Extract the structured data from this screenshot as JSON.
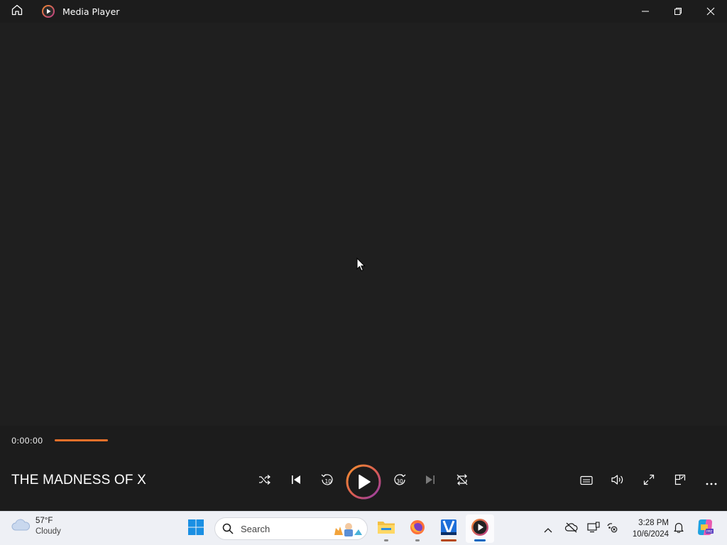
{
  "window": {
    "title": "Media Player"
  },
  "player": {
    "current_time": "0:00:00",
    "progress_fraction": 0.0,
    "track_title": "THE MADNESS OF X",
    "accent_color": "#e8702a"
  },
  "controls": {
    "left": [
      "shuffle-icon",
      "previous-icon",
      "rewind-10-icon",
      "play-icon",
      "forward-30-icon",
      "next-icon",
      "repeat-icon"
    ],
    "right": [
      "captions-icon",
      "volume-icon",
      "fullscreen-icon",
      "mini-player-icon",
      "more-icon"
    ],
    "rewind_label": "10",
    "forward_label": "30"
  },
  "taskbar": {
    "weather": {
      "temp": "57°F",
      "condition": "Cloudy"
    },
    "search_placeholder": "Search",
    "clock": {
      "time": "3:28 PM",
      "date": "10/6/2024"
    }
  }
}
